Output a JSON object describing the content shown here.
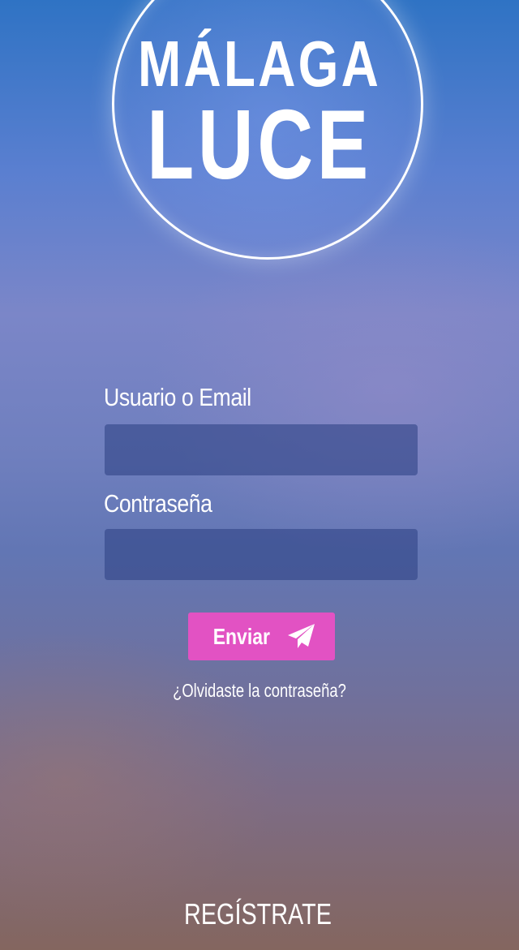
{
  "logo": {
    "line1": "MÁLAGA",
    "line2": "LUCE"
  },
  "login_form": {
    "user_label": "Usuario o Email",
    "user_value": "",
    "password_label": "Contraseña",
    "password_value": "",
    "submit_label": "Enviar",
    "submit_icon": "paper-plane-icon",
    "forgot_password_link": "¿Olvidaste la contraseña?"
  },
  "footer": {
    "register_link": "REGÍSTRATE"
  },
  "colors": {
    "accent_button": "#e252c3",
    "input_background": "#3c4f8e",
    "text": "#ffffff"
  }
}
